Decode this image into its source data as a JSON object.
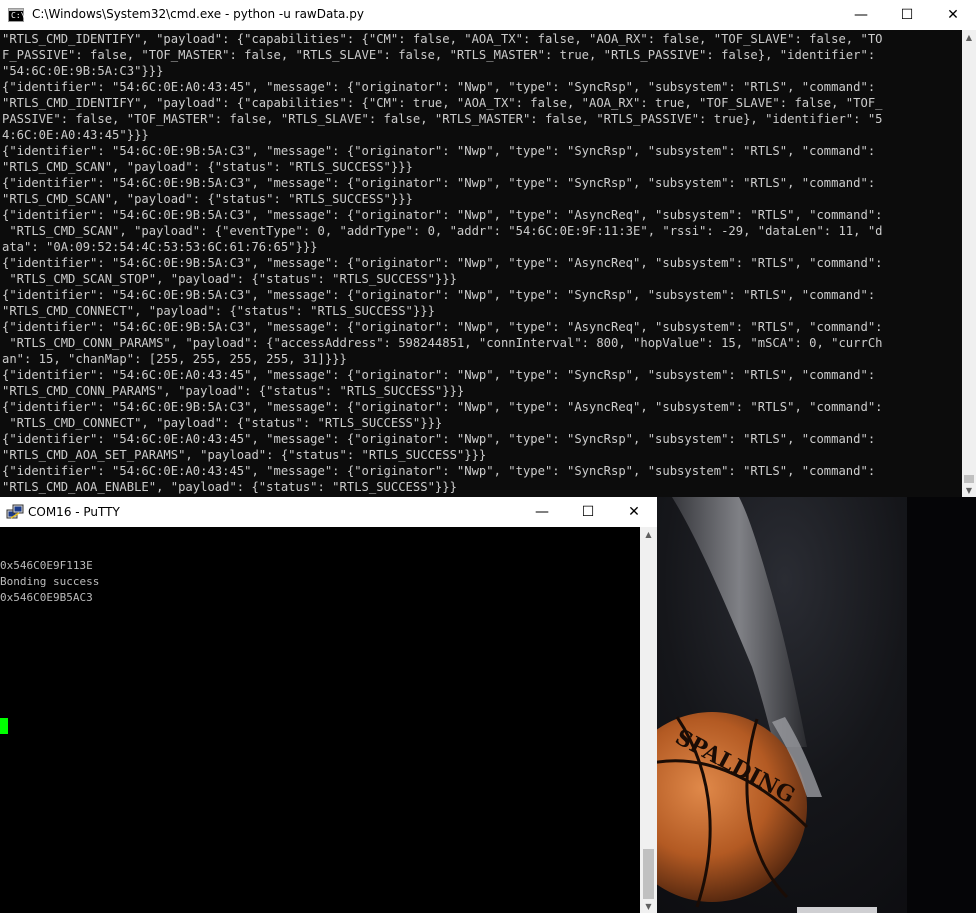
{
  "cmd": {
    "title": "C:\\Windows\\System32\\cmd.exe - python  -u rawData.py",
    "lines": [
      "\"RTLS_CMD_IDENTIFY\", \"payload\": {\"capabilities\": {\"CM\": false, \"AOA_TX\": false, \"AOA_RX\": false, \"TOF_SLAVE\": false, \"TO",
      "F_PASSIVE\": false, \"TOF_MASTER\": false, \"RTLS_SLAVE\": false, \"RTLS_MASTER\": true, \"RTLS_PASSIVE\": false}, \"identifier\":",
      "\"54:6C:0E:9B:5A:C3\"}}}",
      "{\"identifier\": \"54:6C:0E:A0:43:45\", \"message\": {\"originator\": \"Nwp\", \"type\": \"SyncRsp\", \"subsystem\": \"RTLS\", \"command\":",
      "\"RTLS_CMD_IDENTIFY\", \"payload\": {\"capabilities\": {\"CM\": true, \"AOA_TX\": false, \"AOA_RX\": true, \"TOF_SLAVE\": false, \"TOF_",
      "PASSIVE\": false, \"TOF_MASTER\": false, \"RTLS_SLAVE\": false, \"RTLS_MASTER\": false, \"RTLS_PASSIVE\": true}, \"identifier\": \"5",
      "4:6C:0E:A0:43:45\"}}}",
      "{\"identifier\": \"54:6C:0E:9B:5A:C3\", \"message\": {\"originator\": \"Nwp\", \"type\": \"SyncRsp\", \"subsystem\": \"RTLS\", \"command\":",
      "\"RTLS_CMD_SCAN\", \"payload\": {\"status\": \"RTLS_SUCCESS\"}}}",
      "{\"identifier\": \"54:6C:0E:9B:5A:C3\", \"message\": {\"originator\": \"Nwp\", \"type\": \"SyncRsp\", \"subsystem\": \"RTLS\", \"command\":",
      "\"RTLS_CMD_SCAN\", \"payload\": {\"status\": \"RTLS_SUCCESS\"}}}",
      "{\"identifier\": \"54:6C:0E:9B:5A:C3\", \"message\": {\"originator\": \"Nwp\", \"type\": \"AsyncReq\", \"subsystem\": \"RTLS\", \"command\":",
      " \"RTLS_CMD_SCAN\", \"payload\": {\"eventType\": 0, \"addrType\": 0, \"addr\": \"54:6C:0E:9F:11:3E\", \"rssi\": -29, \"dataLen\": 11, \"d",
      "ata\": \"0A:09:52:54:4C:53:53:6C:61:76:65\"}}}",
      "{\"identifier\": \"54:6C:0E:9B:5A:C3\", \"message\": {\"originator\": \"Nwp\", \"type\": \"AsyncReq\", \"subsystem\": \"RTLS\", \"command\":",
      " \"RTLS_CMD_SCAN_STOP\", \"payload\": {\"status\": \"RTLS_SUCCESS\"}}}",
      "{\"identifier\": \"54:6C:0E:9B:5A:C3\", \"message\": {\"originator\": \"Nwp\", \"type\": \"SyncRsp\", \"subsystem\": \"RTLS\", \"command\":",
      "\"RTLS_CMD_CONNECT\", \"payload\": {\"status\": \"RTLS_SUCCESS\"}}}",
      "{\"identifier\": \"54:6C:0E:9B:5A:C3\", \"message\": {\"originator\": \"Nwp\", \"type\": \"AsyncReq\", \"subsystem\": \"RTLS\", \"command\":",
      " \"RTLS_CMD_CONN_PARAMS\", \"payload\": {\"accessAddress\": 598244851, \"connInterval\": 800, \"hopValue\": 15, \"mSCA\": 0, \"currCh",
      "an\": 15, \"chanMap\": [255, 255, 255, 255, 31]}}}",
      "{\"identifier\": \"54:6C:0E:A0:43:45\", \"message\": {\"originator\": \"Nwp\", \"type\": \"SyncRsp\", \"subsystem\": \"RTLS\", \"command\":",
      "\"RTLS_CMD_CONN_PARAMS\", \"payload\": {\"status\": \"RTLS_SUCCESS\"}}}",
      "{\"identifier\": \"54:6C:0E:9B:5A:C3\", \"message\": {\"originator\": \"Nwp\", \"type\": \"AsyncReq\", \"subsystem\": \"RTLS\", \"command\":",
      " \"RTLS_CMD_CONNECT\", \"payload\": {\"status\": \"RTLS_SUCCESS\"}}}",
      "{\"identifier\": \"54:6C:0E:A0:43:45\", \"message\": {\"originator\": \"Nwp\", \"type\": \"SyncRsp\", \"subsystem\": \"RTLS\", \"command\":",
      "\"RTLS_CMD_AOA_SET_PARAMS\", \"payload\": {\"status\": \"RTLS_SUCCESS\"}}}",
      "{\"identifier\": \"54:6C:0E:A0:43:45\", \"message\": {\"originator\": \"Nwp\", \"type\": \"SyncRsp\", \"subsystem\": \"RTLS\", \"command\":",
      "\"RTLS_CMD_AOA_ENABLE\", \"payload\": {\"status\": \"RTLS_SUCCESS\"}}}"
    ]
  },
  "putty": {
    "title": "COM16 - PuTTY",
    "lines": [
      "",
      "0x546C0E9F113E",
      "Bonding success",
      "0x546C0E9B5AC3"
    ],
    "cursor_color": "#00ff00"
  },
  "window_controls": {
    "minimize": "—",
    "maximize": "☐",
    "close": "✕"
  },
  "icons": {
    "cmd": "console-icon",
    "putty": "putty-icon"
  }
}
